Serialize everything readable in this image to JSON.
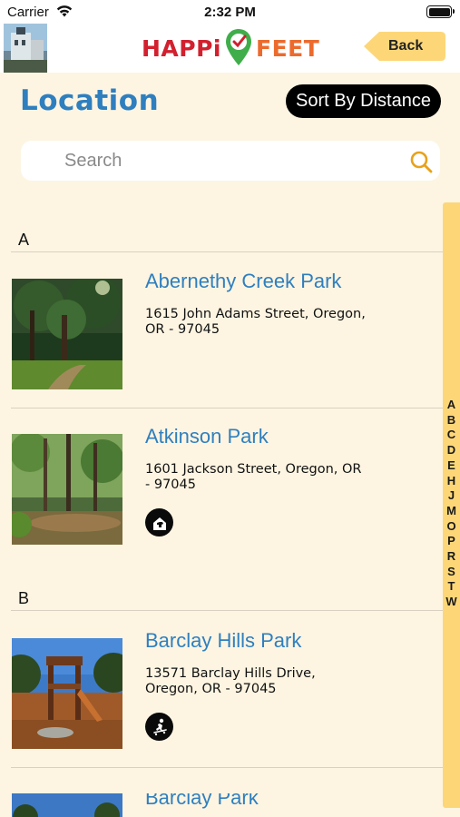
{
  "status_bar": {
    "carrier": "Carrier",
    "time": "2:32 PM"
  },
  "header": {
    "logo_left": "HAPPi",
    "logo_right": "FEET",
    "back_label": "Back"
  },
  "page": {
    "title": "Location",
    "sort_label": "Sort By Distance"
  },
  "search": {
    "placeholder": "Search",
    "value": ""
  },
  "sections": [
    {
      "letter": "A",
      "items": [
        {
          "name": "Abernethy Creek Park",
          "address": "1615 John Adams Street, Oregon, OR - 97045",
          "amenity": null
        },
        {
          "name": "Atkinson Park",
          "address": "1601 Jackson Street, Oregon, OR - 97045",
          "amenity": "dog-park-icon"
        }
      ]
    },
    {
      "letter": "B",
      "items": [
        {
          "name": "Barclay Hills Park",
          "address": "13571 Barclay Hills Drive, Oregon, OR - 97045",
          "amenity": "skateboard-icon"
        },
        {
          "name": "Barclay Park",
          "address": "",
          "amenity": null
        }
      ]
    }
  ],
  "index_letters": [
    "A",
    "B",
    "C",
    "D",
    "E",
    "H",
    "J",
    "M",
    "O",
    "P",
    "R",
    "S",
    "T",
    "W"
  ],
  "colors": {
    "background": "#fdf5e2",
    "accent": "#2f7fbf",
    "index_bar": "#fdd777",
    "search_icon": "#e8a21b"
  }
}
